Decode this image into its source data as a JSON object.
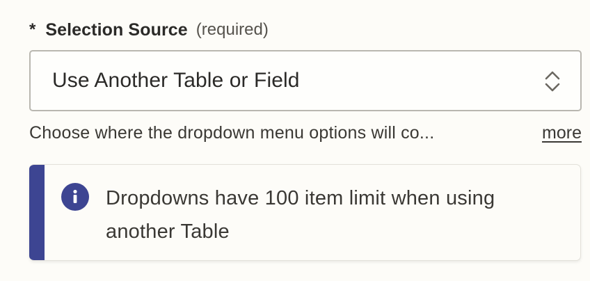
{
  "field": {
    "asterisk": "*",
    "label": "Selection Source",
    "required_text": "(required)"
  },
  "select": {
    "value": "Use Another Table or Field",
    "icon": "chevron-up-down-icon"
  },
  "help": {
    "text": "Choose where the dropdown menu options will co...",
    "more_label": "more"
  },
  "alert": {
    "icon": "info-icon",
    "text": "Dropdowns have 100 item limit when using another Table",
    "accent_color": "#3d4592"
  }
}
